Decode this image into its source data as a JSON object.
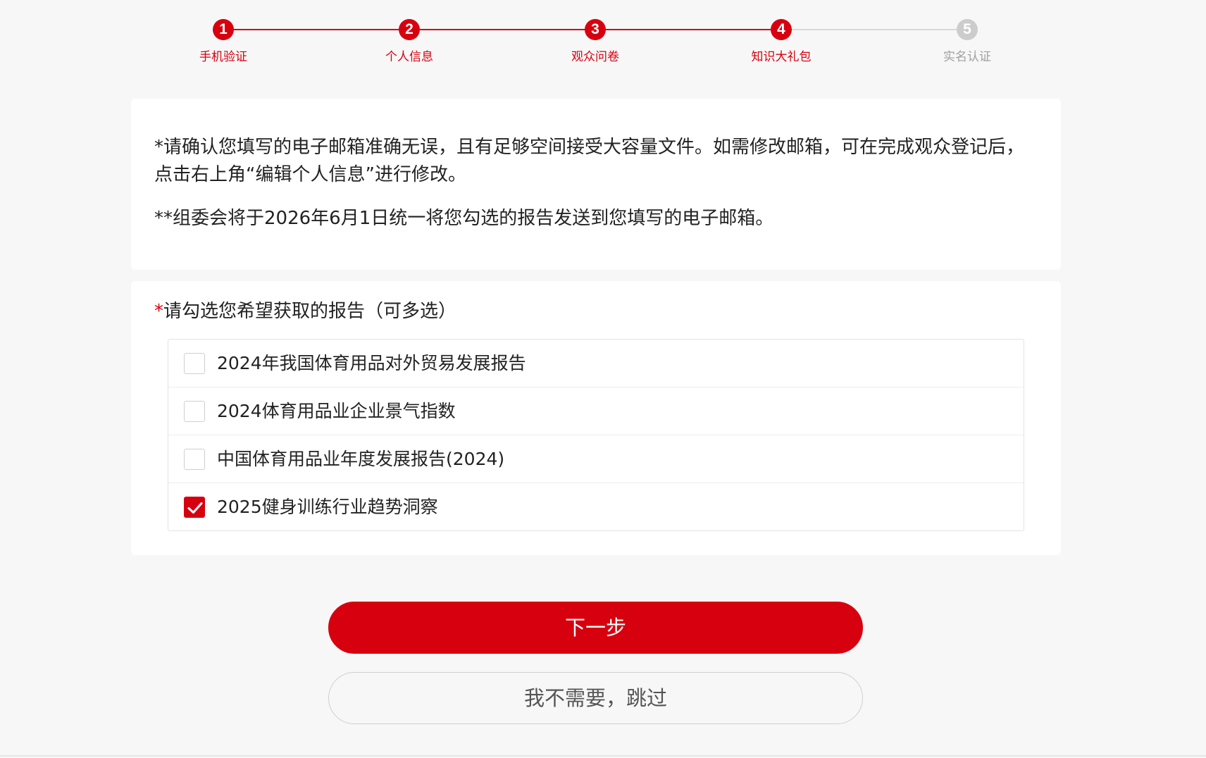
{
  "colors": {
    "accent": "#d7000f",
    "inactive": "#cccccc",
    "text": "#222222"
  },
  "stepper": {
    "current_step": 4,
    "steps": [
      {
        "number": "1",
        "label": "手机验证",
        "state": "done"
      },
      {
        "number": "2",
        "label": "个人信息",
        "state": "done"
      },
      {
        "number": "3",
        "label": "观众问卷",
        "state": "done"
      },
      {
        "number": "4",
        "label": "知识大礼包",
        "state": "active"
      },
      {
        "number": "5",
        "label": "实名认证",
        "state": "pending"
      }
    ]
  },
  "notice": {
    "paragraph1": "*请确认您填写的电子邮箱准确无误，且有足够空间接受大容量文件。如需修改邮箱，可在完成观众登记后，点击右上角“编辑个人信息”进行修改。",
    "paragraph2": "**组委会将于2026年6月1日统一将您勾选的报告发送到您填写的电子邮箱。"
  },
  "report_select": {
    "required_mark": "*",
    "question": "请勾选您希望获取的报告（可多选）",
    "options": [
      {
        "label": "2024年我国体育用品对外贸易发展报告",
        "checked": false
      },
      {
        "label": "2024体育用品业企业景气指数",
        "checked": false
      },
      {
        "label": "中国体育用品业年度发展报告(2024)",
        "checked": false
      },
      {
        "label": "2025健身训练行业趋势洞察",
        "checked": true
      }
    ]
  },
  "buttons": {
    "next": "下一步",
    "skip": "我不需要，跳过"
  },
  "icons": {
    "checkmark": "check-icon"
  }
}
